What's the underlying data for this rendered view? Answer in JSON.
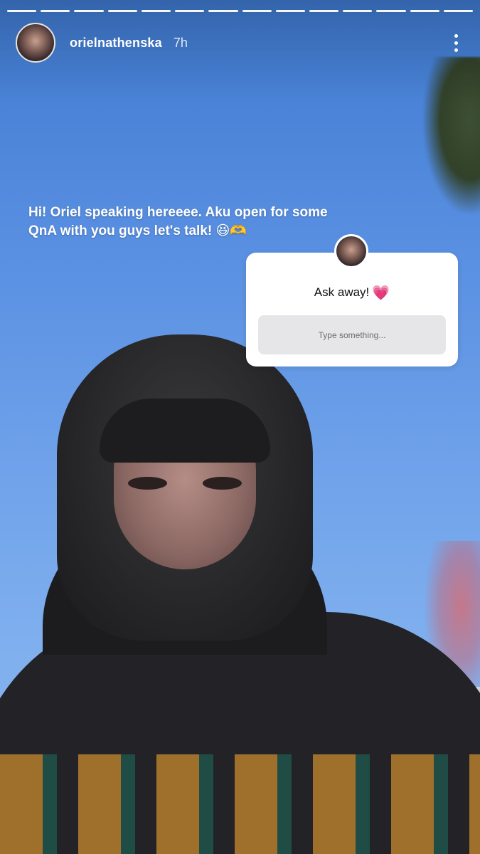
{
  "story": {
    "username": "orielnathenska",
    "time": "7h",
    "segments_total": 14,
    "segments_done": 14
  },
  "caption": {
    "text": "Hi! Oriel speaking hereeee. Aku open for some QnA with you guys let's talk! 😆🫶"
  },
  "question_sticker": {
    "title": "Ask away!",
    "emoji": "💗",
    "placeholder": "Type something..."
  },
  "icons": {
    "more": "more-vertical-icon",
    "heart": "heart-icon"
  },
  "colors": {
    "sky_top": "#3f7ad0",
    "sky_bottom": "#8ab6ef",
    "heart": "#f2457a",
    "input_bg": "#e6e6e8"
  }
}
